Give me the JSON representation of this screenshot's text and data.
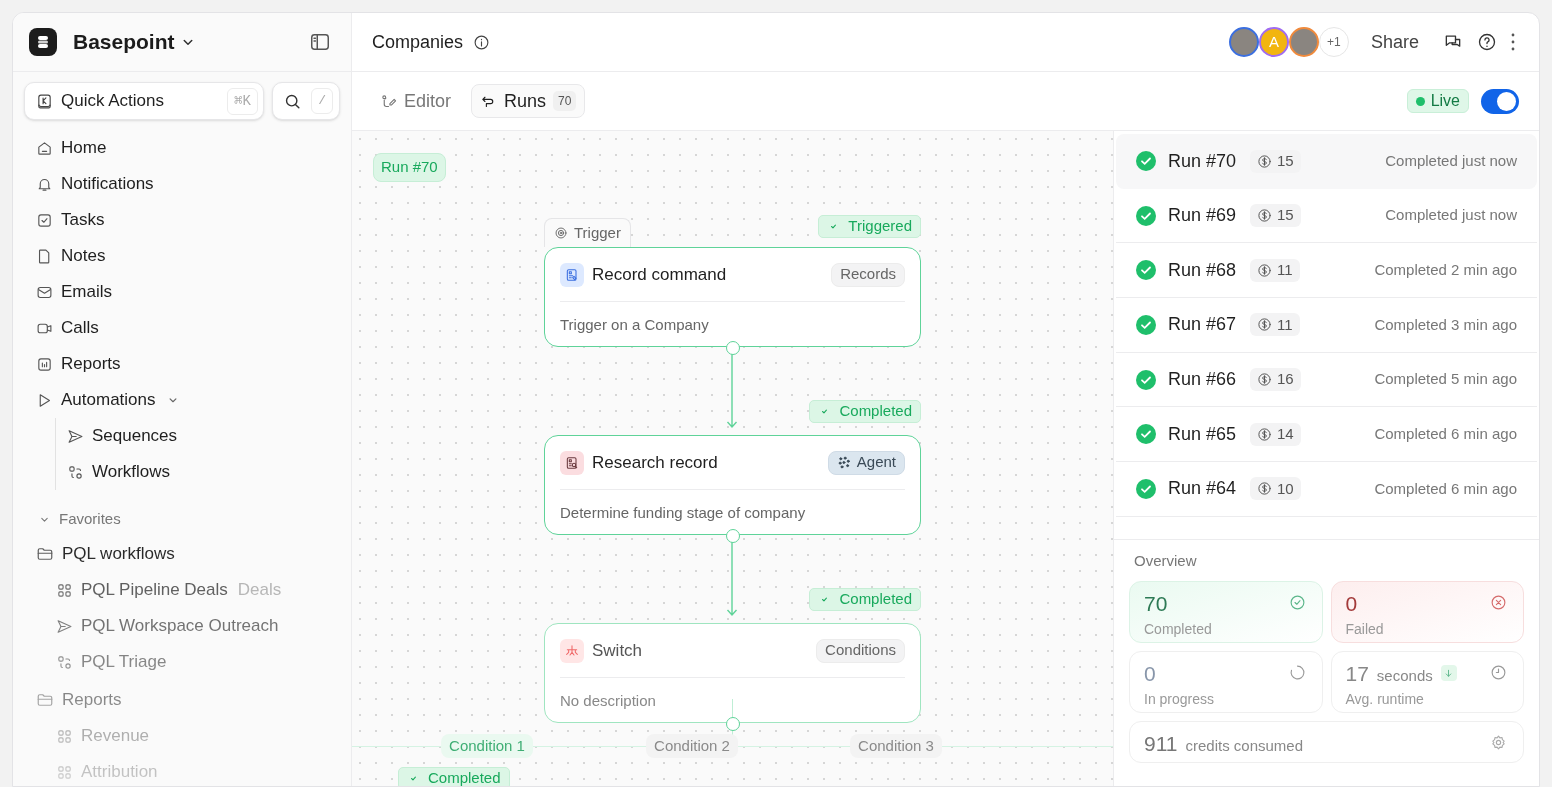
{
  "workspace": {
    "name": "Basepoint"
  },
  "quick_actions": {
    "label": "Quick Actions",
    "shortcut": "⌘K"
  },
  "search": {
    "shortcut": "/"
  },
  "nav": [
    {
      "label": "Home"
    },
    {
      "label": "Notifications"
    },
    {
      "label": "Tasks"
    },
    {
      "label": "Notes"
    },
    {
      "label": "Emails"
    },
    {
      "label": "Calls"
    },
    {
      "label": "Reports"
    },
    {
      "label": "Automations",
      "expanded": true,
      "children": [
        {
          "label": "Sequences"
        },
        {
          "label": "Workflows"
        }
      ]
    }
  ],
  "favorites": {
    "label": "Favorites",
    "expanded": true,
    "folders": [
      {
        "label": "PQL workflows",
        "items": [
          {
            "label": "PQL Pipeline Deals",
            "tag": "Deals"
          },
          {
            "label": "PQL Workspace Outreach"
          },
          {
            "label": "PQL Triage"
          }
        ]
      },
      {
        "label": "Reports",
        "items": [
          {
            "label": "Revenue"
          },
          {
            "label": "Attribution"
          }
        ]
      }
    ]
  },
  "header": {
    "title": "Companies",
    "avatars": [
      {
        "kind": "photo",
        "color": "#3b6fe0"
      },
      {
        "kind": "letter",
        "text": "A",
        "color": "#a06cf0"
      },
      {
        "kind": "photo",
        "color": "#f08a3c"
      }
    ],
    "more_count": "+1",
    "share": "Share"
  },
  "tabs": [
    {
      "label": "Editor",
      "selected": false
    },
    {
      "label": "Runs",
      "count": "70",
      "selected": true
    }
  ],
  "live": {
    "label": "Live",
    "on": true
  },
  "canvas": {
    "run_label": "Run #70",
    "nodes": [
      {
        "kind": "trigger",
        "tab": "Trigger",
        "status": "Triggered",
        "title": "Record command",
        "tag": "Records",
        "description": "Trigger on a Company"
      },
      {
        "kind": "agent",
        "status": "Completed",
        "title": "Research record",
        "tag": "Agent",
        "description": "Determine funding stage of company"
      },
      {
        "kind": "switch",
        "status": "Completed",
        "title": "Switch",
        "tag": "Conditions",
        "description": "No description"
      }
    ],
    "branches": [
      {
        "label": "Condition 1",
        "selected": true
      },
      {
        "label": "Condition 2",
        "selected": false
      },
      {
        "label": "Condition 3",
        "selected": false
      }
    ],
    "branch_status": "Completed"
  },
  "runs": [
    {
      "name": "Run #70",
      "credits": "15",
      "time": "Completed just now",
      "selected": true
    },
    {
      "name": "Run #69",
      "credits": "15",
      "time": "Completed just now",
      "selected": false
    },
    {
      "name": "Run #68",
      "credits": "11",
      "time": "Completed 2 min ago",
      "selected": false
    },
    {
      "name": "Run #67",
      "credits": "11",
      "time": "Completed 3 min ago",
      "selected": false
    },
    {
      "name": "Run #66",
      "credits": "16",
      "time": "Completed 5 min ago",
      "selected": false
    },
    {
      "name": "Run #65",
      "credits": "14",
      "time": "Completed 6 min ago",
      "selected": false
    },
    {
      "name": "Run #64",
      "credits": "10",
      "time": "Completed 6 min ago",
      "selected": false
    }
  ],
  "overview": {
    "title": "Overview",
    "stats": [
      {
        "kind": "completed",
        "value": "70",
        "label": "Completed"
      },
      {
        "kind": "failed",
        "value": "0",
        "label": "Failed"
      },
      {
        "kind": "progress",
        "value": "0",
        "label": "In progress"
      },
      {
        "kind": "runtime",
        "value": "17",
        "unit": "seconds",
        "label": "Avg. runtime"
      },
      {
        "kind": "credits",
        "value": "911",
        "unit": "credits consumed"
      }
    ]
  }
}
